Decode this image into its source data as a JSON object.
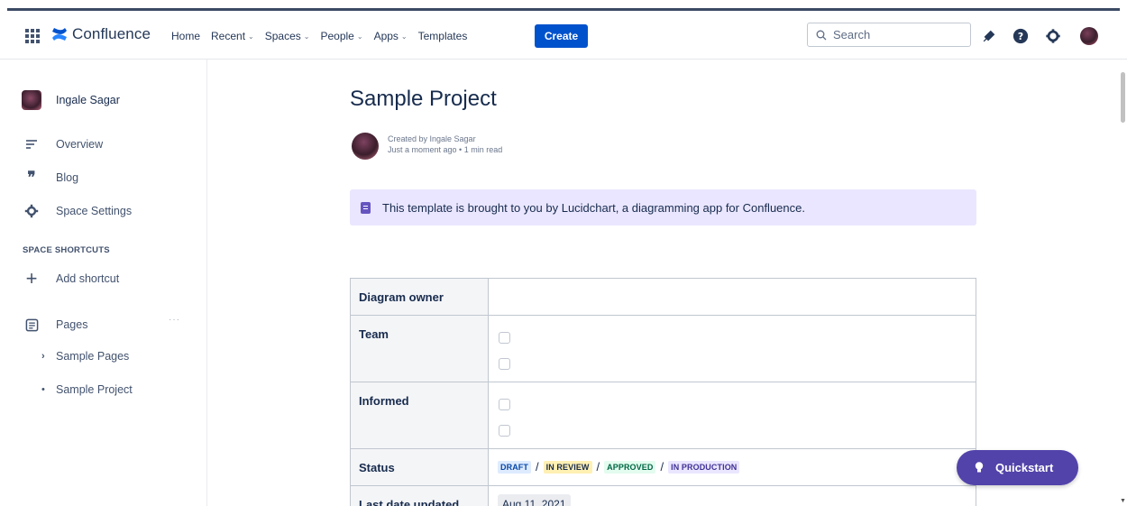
{
  "header": {
    "logo_text": "Confluence",
    "nav": [
      {
        "label": "Home",
        "has_dropdown": false
      },
      {
        "label": "Recent",
        "has_dropdown": true
      },
      {
        "label": "Spaces",
        "has_dropdown": true
      },
      {
        "label": "People",
        "has_dropdown": true
      },
      {
        "label": "Apps",
        "has_dropdown": true
      },
      {
        "label": "Templates",
        "has_dropdown": false
      }
    ],
    "create_label": "Create",
    "search_placeholder": "Search",
    "icons": [
      "notifications-icon",
      "help-icon",
      "settings-icon",
      "user-avatar"
    ]
  },
  "sidebar": {
    "user_name": "Ingale Sagar",
    "items": [
      {
        "label": "Overview",
        "icon": "overview-icon"
      },
      {
        "label": "Blog",
        "icon": "quote-icon"
      },
      {
        "label": "Space Settings",
        "icon": "gear-icon"
      }
    ],
    "shortcuts_heading": "SPACE SHORTCUTS",
    "add_shortcut_label": "Add shortcut",
    "pages_label": "Pages",
    "pages_more": "···",
    "tree": [
      {
        "label": "Sample Pages",
        "marker": "›"
      },
      {
        "label": "Sample Project",
        "marker": "•"
      }
    ]
  },
  "page": {
    "title": "Sample Project",
    "created_by": "Created by Ingale Sagar",
    "timing": "Just a moment ago • 1 min read",
    "info_panel": "This template is brought to you by Lucidchart, a diagramming app for Confluence.",
    "table": {
      "rows": [
        {
          "label": "Diagram owner"
        },
        {
          "label": "Team"
        },
        {
          "label": "Informed"
        },
        {
          "label": "Status"
        },
        {
          "label": "Last date updated"
        }
      ],
      "status_lozenges": [
        {
          "text": "DRAFT",
          "bg": "#DEEBFF",
          "fg": "#0747A6"
        },
        {
          "text": "IN REVIEW",
          "bg": "#FFF0B3",
          "fg": "#172B4D"
        },
        {
          "text": "APPROVED",
          "bg": "#E3FCEF",
          "fg": "#006644"
        },
        {
          "text": "IN PRODUCTION",
          "bg": "#EAE6FF",
          "fg": "#403294"
        }
      ],
      "status_separator": "/",
      "last_updated": "Aug 11, 2021"
    }
  },
  "quickstart_label": "Quickstart",
  "colors": {
    "primary": "#0052CC",
    "quickstart": "#5243AA",
    "info_panel_bg": "#EAE6FF"
  }
}
